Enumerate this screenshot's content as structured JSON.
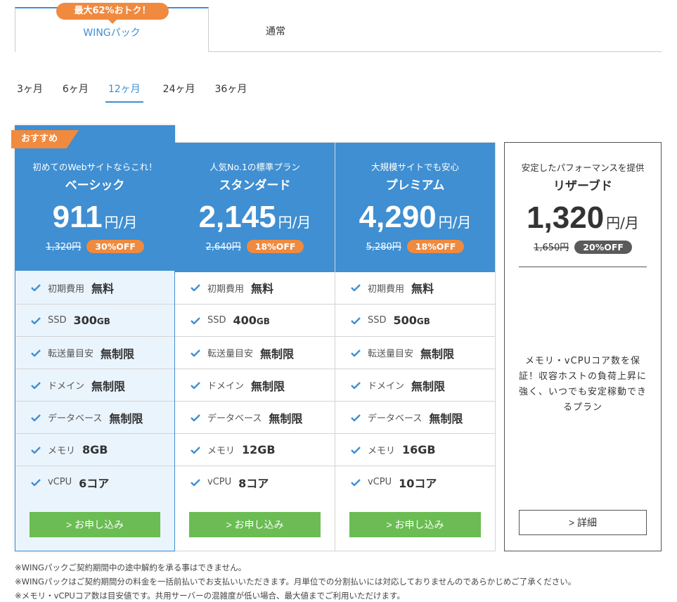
{
  "tabs": {
    "wing": {
      "label": "WINGパック",
      "badge": "最大62%おトク！"
    },
    "normal": {
      "label": "通常"
    }
  },
  "periods": [
    {
      "label": "3ヶ月",
      "active": false
    },
    {
      "label": "6ヶ月",
      "active": false
    },
    {
      "label": "12ヶ月",
      "active": true
    },
    {
      "label": "24ヶ月",
      "active": false
    },
    {
      "label": "36ヶ月",
      "active": false
    }
  ],
  "plans": [
    {
      "ribbon": "おすすめ",
      "catch": "初めてのWebサイトならこれ！",
      "name": "ベーシック",
      "price": "911",
      "unit": "円/月",
      "old_price": "1,320円",
      "off": "30%OFF",
      "features": [
        {
          "label": "初期費用",
          "value": "無料",
          "suffix": ""
        },
        {
          "label": "SSD",
          "value": "300",
          "suffix": "GB"
        },
        {
          "label": "転送量目安",
          "value": "無制限",
          "suffix": ""
        },
        {
          "label": "ドメイン",
          "value": "無制限",
          "suffix": ""
        },
        {
          "label": "データベース",
          "value": "無制限",
          "suffix": ""
        },
        {
          "label": "メモリ",
          "value": "8GB",
          "suffix": ""
        },
        {
          "label": "vCPU",
          "value": "6コア",
          "suffix": ""
        }
      ],
      "button": "お申し込み"
    },
    {
      "catch": "人気No.1の標準プラン",
      "name": "スタンダード",
      "price": "2,145",
      "unit": "円/月",
      "old_price": "2,640円",
      "off": "18%OFF",
      "features": [
        {
          "label": "初期費用",
          "value": "無料",
          "suffix": ""
        },
        {
          "label": "SSD",
          "value": "400",
          "suffix": "GB"
        },
        {
          "label": "転送量目安",
          "value": "無制限",
          "suffix": ""
        },
        {
          "label": "ドメイン",
          "value": "無制限",
          "suffix": ""
        },
        {
          "label": "データベース",
          "value": "無制限",
          "suffix": ""
        },
        {
          "label": "メモリ",
          "value": "12GB",
          "suffix": ""
        },
        {
          "label": "vCPU",
          "value": "8コア",
          "suffix": ""
        }
      ],
      "button": "お申し込み"
    },
    {
      "catch": "大規模サイトでも安心",
      "name": "プレミアム",
      "price": "4,290",
      "unit": "円/月",
      "old_price": "5,280円",
      "off": "18%OFF",
      "features": [
        {
          "label": "初期費用",
          "value": "無料",
          "suffix": ""
        },
        {
          "label": "SSD",
          "value": "500",
          "suffix": "GB"
        },
        {
          "label": "転送量目安",
          "value": "無制限",
          "suffix": ""
        },
        {
          "label": "ドメイン",
          "value": "無制限",
          "suffix": ""
        },
        {
          "label": "データベース",
          "value": "無制限",
          "suffix": ""
        },
        {
          "label": "メモリ",
          "value": "16GB",
          "suffix": ""
        },
        {
          "label": "vCPU",
          "value": "10コア",
          "suffix": ""
        }
      ],
      "button": "お申し込み"
    }
  ],
  "reserved": {
    "catch": "安定したパフォーマンスを提供",
    "name": "リザーブド",
    "price": "1,320",
    "unit": "円/月",
    "old_price": "1,650円",
    "off": "20%OFF",
    "description": "メモリ・vCPUコア数を保証！収容ホストの負荷上昇に強く、いつでも安定稼動できるプラン",
    "button": "詳細"
  },
  "notes": [
    "※WINGパックご契約期間中の途中解約を承る事はできません。",
    "※WINGパックはご契約期間分の料金を一括前払いでお支払いいただきます。月単位での分割払いには対応しておりませんのであらかじめご了承ください。",
    "※メモリ・vCPUコア数は目安値です。共用サーバーの混雑度が低い場合、最大値までご利用いただけます。"
  ],
  "colors": {
    "accent": "#3f8fd2",
    "orange": "#f08a3e",
    "green": "#6abc53",
    "gray_badge": "#5a5a5a"
  },
  "icons": {
    "feature": "check-icon",
    "button": "chevron-right-icon"
  }
}
